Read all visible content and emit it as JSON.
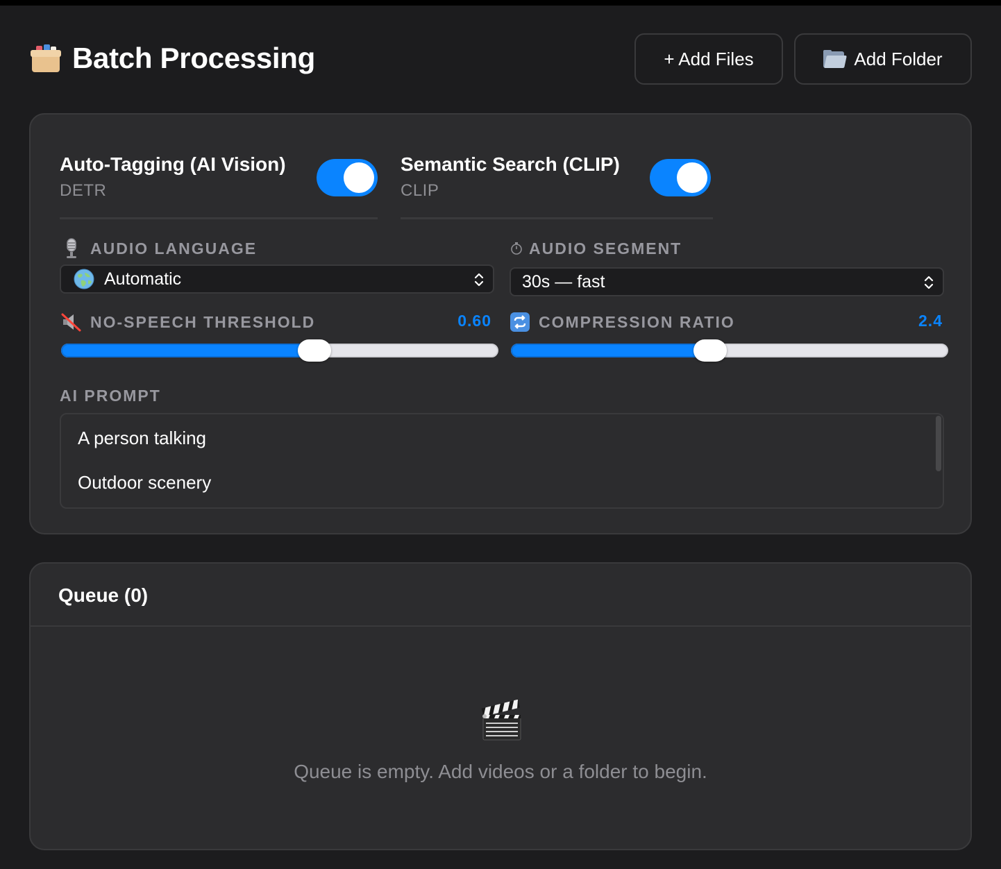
{
  "header": {
    "title": "Batch Processing",
    "title_icon": "card-file-box-icon",
    "add_files_label": "+ Add Files",
    "add_folder_label": "Add Folder",
    "add_folder_icon": "folder-icon"
  },
  "settings": {
    "auto_tagging": {
      "label": "Auto-Tagging (AI Vision)",
      "model": "DETR",
      "enabled": true
    },
    "semantic_search": {
      "label": "Semantic Search (CLIP)",
      "model": "CLIP",
      "enabled": true
    },
    "audio_language": {
      "label": "AUDIO LANGUAGE",
      "icon": "microphone-icon",
      "value": "Automatic",
      "value_icon": "globe-icon"
    },
    "audio_segment": {
      "label": "AUDIO SEGMENT",
      "icon": "stopwatch-icon",
      "value": "30s — fast"
    },
    "no_speech_threshold": {
      "label": "NO-SPEECH THRESHOLD",
      "icon": "muted-speaker-icon",
      "display": "0.60",
      "value": 0.6,
      "fill_fraction": 0.58
    },
    "compression_ratio": {
      "label": "COMPRESSION RATIO",
      "icon": "repeat-icon",
      "display": "2.4",
      "value": 2.4,
      "fill_fraction": 0.455
    },
    "ai_prompt": {
      "label": "AI PROMPT",
      "lines": [
        "A person talking",
        "Outdoor scenery"
      ]
    }
  },
  "queue": {
    "title": "Queue (0)",
    "empty_icon": "clapper-board-icon",
    "empty_message": "Queue is empty. Add videos or a folder to begin."
  },
  "colors": {
    "accent": "#0a84ff",
    "background": "#1c1c1e",
    "panel": "#2c2c2e",
    "border": "#3a3a3c",
    "muted": "#8e8e93"
  }
}
